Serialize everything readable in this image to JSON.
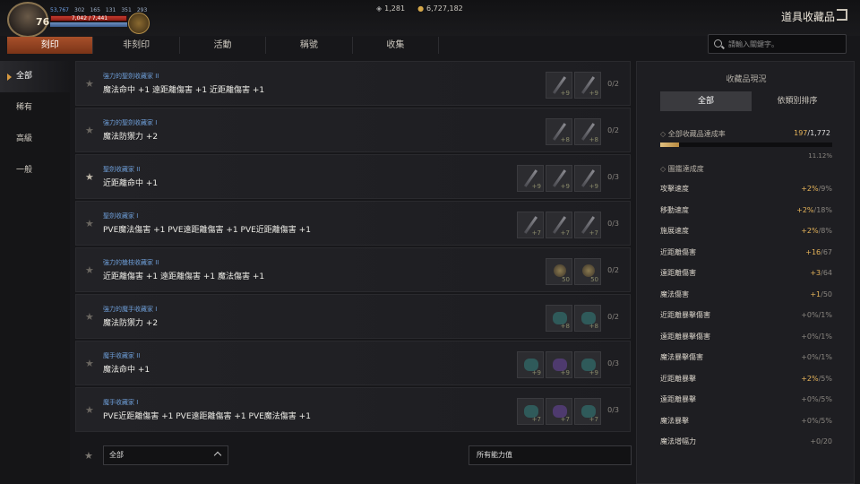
{
  "player": {
    "level": "76",
    "hp_text": "7,042 / 7,441",
    "stats": [
      "53,767",
      "302",
      "165",
      "131",
      "351",
      "293"
    ]
  },
  "currency": {
    "crystal": "1,281",
    "gold": "6,727,182"
  },
  "page_title": "道具收藏品",
  "tabs": [
    "刻印",
    "非刻印",
    "活動",
    "稱號",
    "收集"
  ],
  "search": {
    "placeholder": "請輸入關鍵字。"
  },
  "sidebar": {
    "items": [
      "全部",
      "稀有",
      "高級",
      "一般"
    ]
  },
  "collections": [
    {
      "name": "強力的聖劍收藏家 II",
      "effect": "魔法命中 +1 遠距離傷害 +1 近距離傷害 +1",
      "slots": [
        {
          "type": "blade",
          "lv": "+9"
        },
        {
          "type": "blade",
          "lv": "+9"
        }
      ],
      "count": "0/2",
      "starred": false
    },
    {
      "name": "強力的聖劍收藏家 I",
      "effect": "魔法防禦力 +2",
      "slots": [
        {
          "type": "blade",
          "lv": "+8"
        },
        {
          "type": "blade",
          "lv": "+8"
        }
      ],
      "count": "0/2",
      "starred": false
    },
    {
      "name": "聖劍收藏家 II",
      "effect": "近距離命中 +1",
      "slots": [
        {
          "type": "blade",
          "lv": "+9"
        },
        {
          "type": "blade",
          "lv": "+9"
        },
        {
          "type": "blade",
          "lv": "+9"
        }
      ],
      "count": "0/3",
      "starred": true
    },
    {
      "name": "聖劍收藏家 I",
      "effect": "PVE魔法傷害 +1 PVE遠距離傷害 +1 PVE近距離傷害 +1",
      "slots": [
        {
          "type": "blade",
          "lv": "+7"
        },
        {
          "type": "blade",
          "lv": "+7"
        },
        {
          "type": "blade",
          "lv": "+7"
        }
      ],
      "count": "0/3",
      "starred": false
    },
    {
      "name": "強力的槍枝收藏家 II",
      "effect": "近距離傷害 +1 遠距離傷害 +1 魔法傷害 +1",
      "slots": [
        {
          "type": "orb",
          "lv": "50"
        },
        {
          "type": "orb",
          "lv": "50"
        }
      ],
      "count": "0/2",
      "starred": false
    },
    {
      "name": "強力的魔手收藏家 I",
      "effect": "魔法防禦力 +2",
      "slots": [
        {
          "type": "glove",
          "lv": "+8"
        },
        {
          "type": "glove",
          "lv": "+8"
        }
      ],
      "count": "0/2",
      "starred": false
    },
    {
      "name": "魔手收藏家 II",
      "effect": "魔法命中 +1",
      "slots": [
        {
          "type": "glove",
          "lv": "+9"
        },
        {
          "type": "glove-purple",
          "lv": "+9"
        },
        {
          "type": "glove",
          "lv": "+9"
        }
      ],
      "count": "0/3",
      "starred": false
    },
    {
      "name": "魔手收藏家 I",
      "effect": "PVE近距離傷害 +1 PVE遠距離傷害 +1 PVE魔法傷害 +1",
      "slots": [
        {
          "type": "glove",
          "lv": "+7"
        },
        {
          "type": "glove-purple",
          "lv": "+7"
        },
        {
          "type": "glove",
          "lv": "+7"
        }
      ],
      "count": "0/3",
      "starred": false
    }
  ],
  "filter": {
    "grade": "全部",
    "ability": "所有能力值"
  },
  "panel": {
    "title": "收藏品現況",
    "tabs": [
      "全部",
      "依類別排序"
    ],
    "rate_label": "全部收藏品達成率",
    "rate_done": "197",
    "rate_total": "/1,772",
    "rate_percent": "11.12%",
    "rate_fraction": 0.1112,
    "codex_label": "圖鑑達成度",
    "stats": [
      {
        "name": "攻擊速度",
        "val": "+2%",
        "max": "/9%"
      },
      {
        "name": "移動速度",
        "val": "+2%",
        "max": "/18%"
      },
      {
        "name": "施展速度",
        "val": "+2%",
        "max": "/8%"
      },
      {
        "name": "近距離傷害",
        "val": "+16",
        "max": "/67"
      },
      {
        "name": "遠距離傷害",
        "val": "+3",
        "max": "/64"
      },
      {
        "name": "魔法傷害",
        "val": "+1",
        "max": "/50"
      },
      {
        "name": "近距離暴擊傷害",
        "val": "+0%",
        "max": "/1%",
        "zero": true
      },
      {
        "name": "遠距離暴擊傷害",
        "val": "+0%",
        "max": "/1%",
        "zero": true
      },
      {
        "name": "魔法暴擊傷害",
        "val": "+0%",
        "max": "/1%",
        "zero": true
      },
      {
        "name": "近距離暴擊",
        "val": "+2%",
        "max": "/5%"
      },
      {
        "name": "遠距離暴擊",
        "val": "+0%",
        "max": "/5%",
        "zero": true
      },
      {
        "name": "魔法暴擊",
        "val": "+0%",
        "max": "/5%",
        "zero": true
      },
      {
        "name": "魔法增幅力",
        "val": "+0",
        "max": "/20",
        "zero": true
      }
    ]
  }
}
